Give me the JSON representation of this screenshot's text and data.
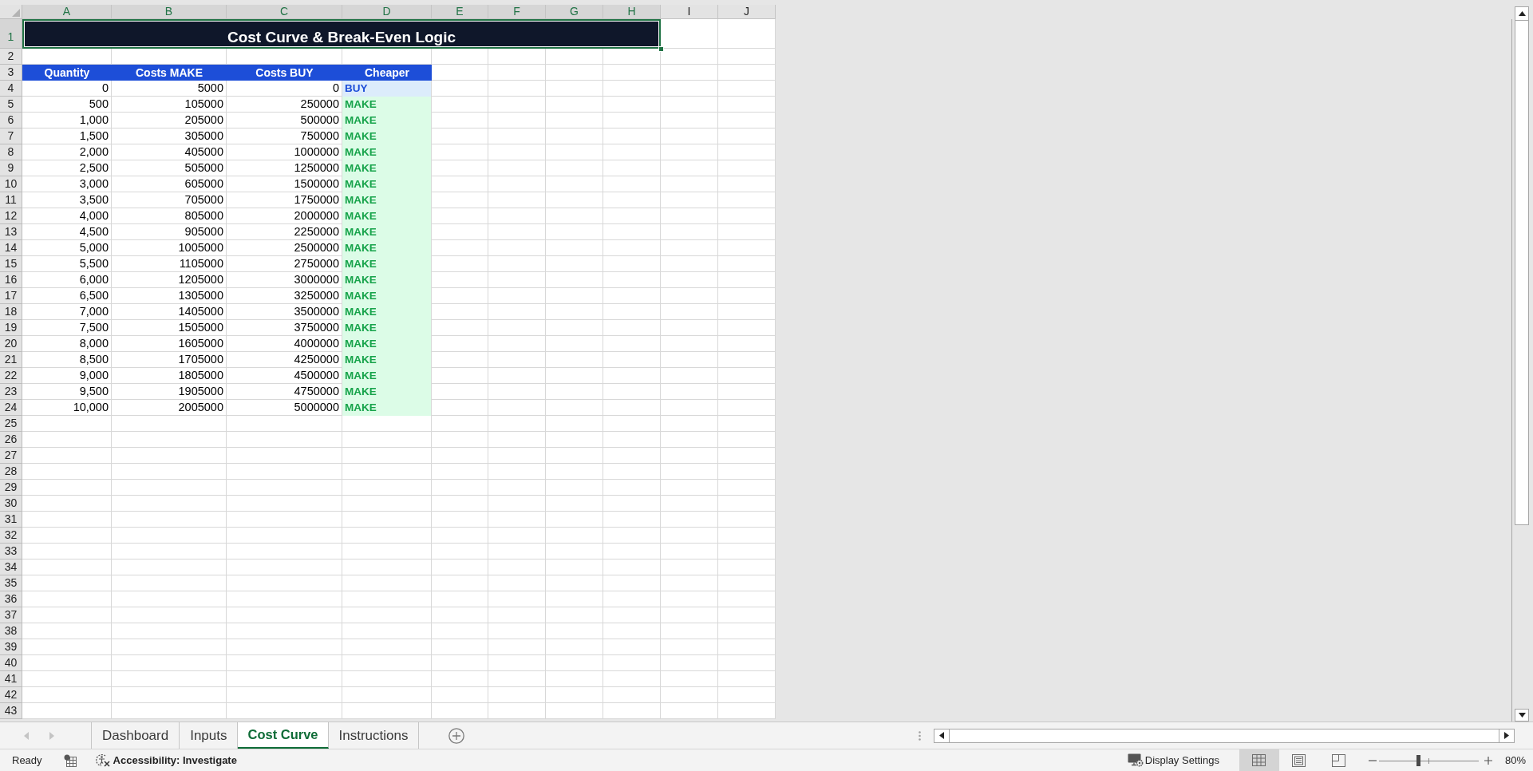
{
  "column_headers": [
    {
      "label": "A",
      "selected": true
    },
    {
      "label": "B",
      "selected": true
    },
    {
      "label": "C",
      "selected": true
    },
    {
      "label": "D",
      "selected": true
    },
    {
      "label": "E",
      "selected": true
    },
    {
      "label": "F",
      "selected": true
    },
    {
      "label": "G",
      "selected": true
    },
    {
      "label": "H",
      "selected": true
    },
    {
      "label": "I",
      "selected": false
    },
    {
      "label": "J",
      "selected": false
    }
  ],
  "row_headers": [
    {
      "label": "1",
      "selected": true
    },
    {
      "label": "2",
      "selected": false
    },
    {
      "label": "3",
      "selected": false
    },
    {
      "label": "4",
      "selected": false
    },
    {
      "label": "5",
      "selected": false
    },
    {
      "label": "6",
      "selected": false
    },
    {
      "label": "7",
      "selected": false
    },
    {
      "label": "8",
      "selected": false
    },
    {
      "label": "9",
      "selected": false
    },
    {
      "label": "10",
      "selected": false
    },
    {
      "label": "11",
      "selected": false
    },
    {
      "label": "12",
      "selected": false
    },
    {
      "label": "13",
      "selected": false
    },
    {
      "label": "14",
      "selected": false
    },
    {
      "label": "15",
      "selected": false
    },
    {
      "label": "16",
      "selected": false
    },
    {
      "label": "17",
      "selected": false
    },
    {
      "label": "18",
      "selected": false
    },
    {
      "label": "19",
      "selected": false
    },
    {
      "label": "20",
      "selected": false
    },
    {
      "label": "21",
      "selected": false
    },
    {
      "label": "22",
      "selected": false
    },
    {
      "label": "23",
      "selected": false
    },
    {
      "label": "24",
      "selected": false
    },
    {
      "label": "25",
      "selected": false
    },
    {
      "label": "26",
      "selected": false
    },
    {
      "label": "27",
      "selected": false
    },
    {
      "label": "28",
      "selected": false
    },
    {
      "label": "29",
      "selected": false
    },
    {
      "label": "30",
      "selected": false
    },
    {
      "label": "31",
      "selected": false
    },
    {
      "label": "32",
      "selected": false
    },
    {
      "label": "33",
      "selected": false
    },
    {
      "label": "34",
      "selected": false
    },
    {
      "label": "35",
      "selected": false
    },
    {
      "label": "36",
      "selected": false
    },
    {
      "label": "37",
      "selected": false
    },
    {
      "label": "38",
      "selected": false
    },
    {
      "label": "39",
      "selected": false
    },
    {
      "label": "40",
      "selected": false
    },
    {
      "label": "41",
      "selected": false
    },
    {
      "label": "42",
      "selected": false
    },
    {
      "label": "43",
      "selected": false
    }
  ],
  "title": "Cost Curve & Break-Even Logic",
  "table": {
    "columns": [
      "Quantity",
      "Costs MAKE",
      "Costs BUY",
      "Cheaper"
    ],
    "rows": [
      {
        "quantity": "0",
        "make": "5000",
        "buy": "0",
        "cheaper": "BUY",
        "kind": "buy"
      },
      {
        "quantity": "500",
        "make": "105000",
        "buy": "250000",
        "cheaper": "MAKE",
        "kind": "make"
      },
      {
        "quantity": "1,000",
        "make": "205000",
        "buy": "500000",
        "cheaper": "MAKE",
        "kind": "make"
      },
      {
        "quantity": "1,500",
        "make": "305000",
        "buy": "750000",
        "cheaper": "MAKE",
        "kind": "make"
      },
      {
        "quantity": "2,000",
        "make": "405000",
        "buy": "1000000",
        "cheaper": "MAKE",
        "kind": "make"
      },
      {
        "quantity": "2,500",
        "make": "505000",
        "buy": "1250000",
        "cheaper": "MAKE",
        "kind": "make"
      },
      {
        "quantity": "3,000",
        "make": "605000",
        "buy": "1500000",
        "cheaper": "MAKE",
        "kind": "make"
      },
      {
        "quantity": "3,500",
        "make": "705000",
        "buy": "1750000",
        "cheaper": "MAKE",
        "kind": "make"
      },
      {
        "quantity": "4,000",
        "make": "805000",
        "buy": "2000000",
        "cheaper": "MAKE",
        "kind": "make"
      },
      {
        "quantity": "4,500",
        "make": "905000",
        "buy": "2250000",
        "cheaper": "MAKE",
        "kind": "make"
      },
      {
        "quantity": "5,000",
        "make": "1005000",
        "buy": "2500000",
        "cheaper": "MAKE",
        "kind": "make"
      },
      {
        "quantity": "5,500",
        "make": "1105000",
        "buy": "2750000",
        "cheaper": "MAKE",
        "kind": "make"
      },
      {
        "quantity": "6,000",
        "make": "1205000",
        "buy": "3000000",
        "cheaper": "MAKE",
        "kind": "make"
      },
      {
        "quantity": "6,500",
        "make": "1305000",
        "buy": "3250000",
        "cheaper": "MAKE",
        "kind": "make"
      },
      {
        "quantity": "7,000",
        "make": "1405000",
        "buy": "3500000",
        "cheaper": "MAKE",
        "kind": "make"
      },
      {
        "quantity": "7,500",
        "make": "1505000",
        "buy": "3750000",
        "cheaper": "MAKE",
        "kind": "make"
      },
      {
        "quantity": "8,000",
        "make": "1605000",
        "buy": "4000000",
        "cheaper": "MAKE",
        "kind": "make"
      },
      {
        "quantity": "8,500",
        "make": "1705000",
        "buy": "4250000",
        "cheaper": "MAKE",
        "kind": "make"
      },
      {
        "quantity": "9,000",
        "make": "1805000",
        "buy": "4500000",
        "cheaper": "MAKE",
        "kind": "make"
      },
      {
        "quantity": "9,500",
        "make": "1905000",
        "buy": "4750000",
        "cheaper": "MAKE",
        "kind": "make"
      },
      {
        "quantity": "10,000",
        "make": "2005000",
        "buy": "5000000",
        "cheaper": "MAKE",
        "kind": "make"
      }
    ]
  },
  "sheet_tabs": [
    {
      "label": "Dashboard",
      "selected": false
    },
    {
      "label": "Inputs",
      "selected": false
    },
    {
      "label": "Cost Curve",
      "selected": true
    },
    {
      "label": "Instructions",
      "selected": false
    }
  ],
  "status_bar": {
    "mode": "Ready",
    "accessibility": "Accessibility: Investigate",
    "display_settings": "Display Settings",
    "view_buttons": [
      {
        "kind": "normal",
        "selected": true
      },
      {
        "kind": "page_layout",
        "selected": false
      },
      {
        "kind": "page_break",
        "selected": false
      }
    ],
    "zoom": {
      "level": 0.4,
      "reading": "80%"
    }
  }
}
